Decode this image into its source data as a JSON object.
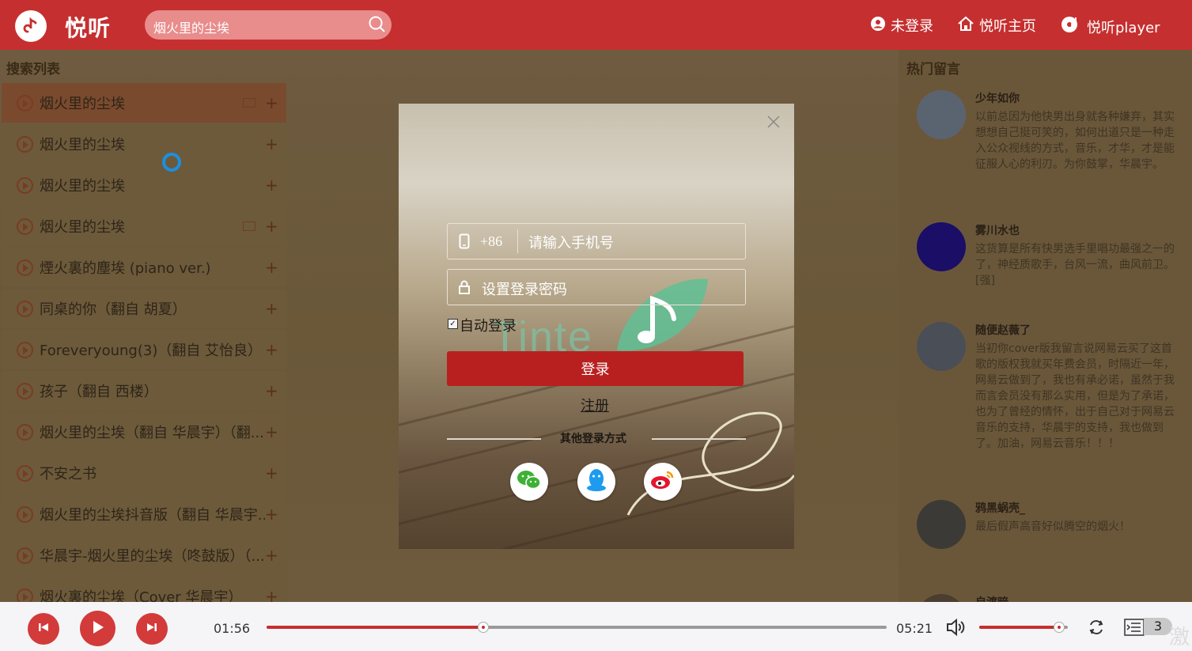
{
  "header": {
    "brand": "悦听",
    "search_value": "烟火里的尘埃",
    "nav": [
      "未登录",
      "悦听主页",
      "悦听player"
    ]
  },
  "left": {
    "title": "搜索列表",
    "songs": [
      "烟火里的尘埃",
      "烟火里的尘埃",
      "烟火里的尘埃",
      "烟火里的尘埃",
      "煙火裏的塵埃 (piano ver.)",
      "同桌的你（翻自 胡夏）",
      "Foreveryoung(3)（翻自 艾怡良）",
      "孩子（翻自 西楼）",
      "烟火里的尘埃（翻自 华晨宇）（翻...",
      "不安之书",
      "烟火里的尘埃抖音版（翻自 华晨宇...",
      "华晨宇-烟火里的尘埃（咚鼓版）（...",
      "烟火裏的尘埃（Cover 华晨宇）"
    ],
    "add_symbol": "+"
  },
  "right": {
    "title": "热门留言",
    "comments": [
      {
        "user": "少年如你",
        "text": "以前总因为他快男出身就各种嫌弃，其实想想自己挺可笑的，如何出道只是一种走入公众视线的方式，音乐，才华，才是能征服人心的利刃。为你鼓掌，华晨宇。"
      },
      {
        "user": "雾川水也",
        "text": "这货算是所有快男选手里唱功最强之一的了，神经质歌手，台风一流，曲风前卫。[强]"
      },
      {
        "user": "随便赵薇了",
        "text": "当初你cover版我留言说网易云买了这首歌的版权我就买年费会员，时隔近一年，网易云做到了，我也有承必诺，虽然于我而言会员没有那么实用，但是为了承诺，也为了曾经的情怀，出于自己对于网易云音乐的支持，华晨宇的支持，我也做到了。加油，网易云音乐！！！"
      },
      {
        "user": "鸦黑蜗壳_",
        "text": "最后假声高音好似腾空的烟火！"
      },
      {
        "user": "自渡暗",
        "text": ""
      }
    ]
  },
  "modal": {
    "country_code": "+86",
    "phone_placeholder": "请输入手机号",
    "password_placeholder": "设置登录密码",
    "auto_login": "自动登录",
    "login_button": "登录",
    "register": "注册",
    "other_login": "其他登录方式",
    "watermark": "Tinte"
  },
  "player": {
    "current_time": "01:56",
    "total_time": "05:21",
    "progress": 0.35,
    "volume": 0.9,
    "playlist_count": "3",
    "corner_text": "激"
  },
  "colors": {
    "brand": "#c62f2f",
    "button_red": "#d33a3a"
  }
}
